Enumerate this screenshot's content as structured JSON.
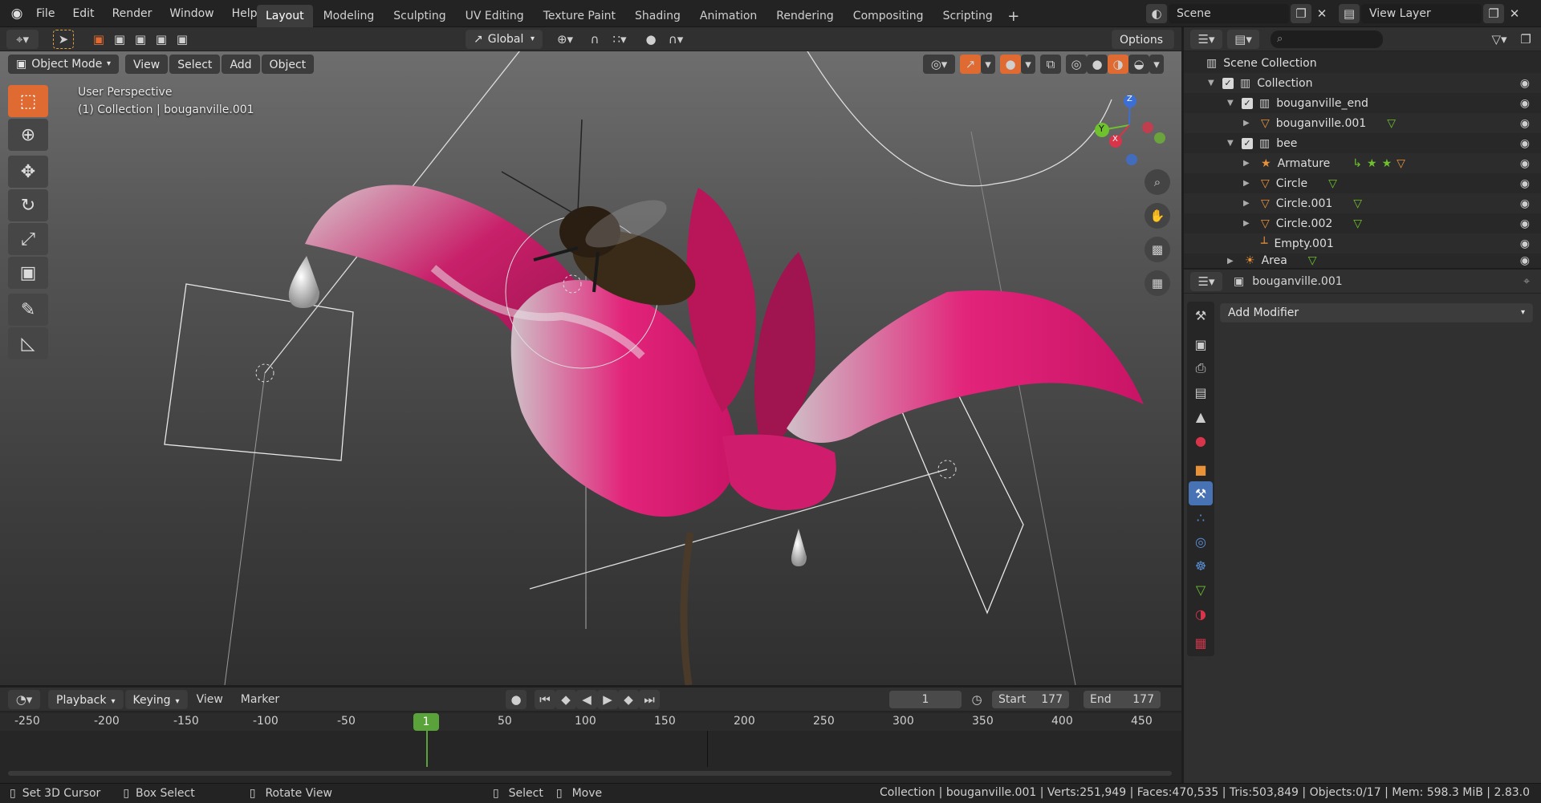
{
  "app": {
    "logo_icon": "blender-logo-icon"
  },
  "menu": [
    "File",
    "Edit",
    "Render",
    "Window",
    "Help"
  ],
  "workspaces": [
    "Layout",
    "Modeling",
    "Sculpting",
    "UV Editing",
    "Texture Paint",
    "Shading",
    "Animation",
    "Rendering",
    "Compositing",
    "Scripting"
  ],
  "active_workspace": "Layout",
  "scene": {
    "label": "Scene",
    "view_layer": "View Layer"
  },
  "tool_header": {
    "transform_orientation": "Global",
    "options_label": "Options"
  },
  "viewport_header": {
    "mode": "Object Mode",
    "menus": [
      "View",
      "Select",
      "Add",
      "Object"
    ]
  },
  "viewport": {
    "perspective": "User Perspective",
    "context": "(1) Collection | bouganville.001",
    "gizmo_axes": [
      "Z",
      "Y",
      "X"
    ]
  },
  "toolbar_icons": [
    "select-box-icon",
    "cursor-icon",
    "move-icon",
    "rotate-icon",
    "scale-icon",
    "transform-icon",
    "annotate-icon",
    "measure-icon"
  ],
  "outliner": {
    "search_placeholder": "",
    "rows": [
      {
        "label": "Scene Collection",
        "icon": "scene-collection-icon"
      },
      {
        "label": "Collection",
        "icon": "collection-icon"
      },
      {
        "label": "bouganville_end",
        "icon": "collection-icon"
      },
      {
        "label": "bouganville.001",
        "icon": "mesh-icon"
      },
      {
        "label": "bee",
        "icon": "collection-icon"
      },
      {
        "label": "Armature",
        "icon": "armature-icon"
      },
      {
        "label": "Circle",
        "icon": "mesh-icon"
      },
      {
        "label": "Circle.001",
        "icon": "mesh-icon"
      },
      {
        "label": "Circle.002",
        "icon": "mesh-icon"
      },
      {
        "label": "Empty.001",
        "icon": "empty-icon"
      },
      {
        "label": "Area",
        "icon": "light-icon"
      }
    ]
  },
  "properties": {
    "object_name": "bouganville.001",
    "add_modifier": "Add Modifier"
  },
  "timeline": {
    "menus": [
      "Playback",
      "Keying",
      "View",
      "Marker"
    ],
    "current_frame": "1",
    "start_label": "Start",
    "start": "177",
    "end_label": "End",
    "end": "177",
    "ruler": [
      "-250",
      "-200",
      "-150",
      "-100",
      "-50",
      "1",
      "50",
      "100",
      "150",
      "200",
      "250",
      "300",
      "350",
      "400",
      "450"
    ],
    "playhead_label": "1"
  },
  "statusbar": {
    "hints": [
      "Set 3D Cursor",
      "Box Select",
      "Rotate View",
      "Select",
      "Move"
    ],
    "stats": "Collection | bouganville.001 | Verts:251,949 | Faces:470,535 | Tris:503,849 | Objects:0/17 | Mem: 598.3 MiB | 2.83.0"
  },
  "colors": {
    "accent": "#e06b32",
    "petal": "#d21a6a",
    "playhead": "#5aa33a",
    "header": "#303030"
  }
}
